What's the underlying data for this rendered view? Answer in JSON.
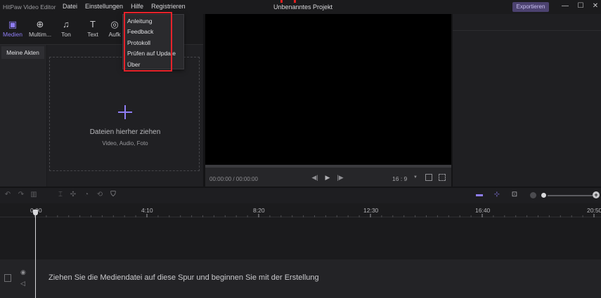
{
  "titlebar": {
    "app_title": "HitPaw Video Editor",
    "menu": [
      "Datei",
      "Einstellungen",
      "Hilfe",
      "Registrieren"
    ],
    "project_title": "Unbenanntes Projekt",
    "export_label": "Exportieren",
    "window_controls": {
      "minimize": "—",
      "maximize": "☐",
      "close": "✕"
    }
  },
  "tabs": [
    {
      "label": "Medien",
      "icon": "media-icon",
      "glyph": "▣",
      "active": true
    },
    {
      "label": "Multim...",
      "icon": "globe-icon",
      "glyph": "⊕",
      "active": false
    },
    {
      "label": "Ton",
      "icon": "music-note-icon",
      "glyph": "♫",
      "active": false
    },
    {
      "label": "Text",
      "icon": "text-icon",
      "glyph": "T",
      "active": false
    },
    {
      "label": "Aufk",
      "icon": "sticker-icon",
      "glyph": "◎",
      "active": false
    }
  ],
  "leftnav": {
    "items": [
      "Meine Akten"
    ]
  },
  "media": {
    "drop_title": "Dateien hierher ziehen",
    "drop_subtitle": "Video, Audio, Foto"
  },
  "help_menu": {
    "items": [
      "Anleitung",
      "Feedback",
      "Protokoll",
      "Prüfen auf Update",
      "Über"
    ]
  },
  "preview": {
    "timecode": "00:00:00 / 00:00:00",
    "aspect_ratio": "16 : 9",
    "controls": {
      "prev": "◀|",
      "play": "▶",
      "next": "|▶"
    }
  },
  "timeline": {
    "ruler_labels": [
      "0:00",
      "4:10",
      "8:20",
      "12:30",
      "16:40",
      "20:50"
    ],
    "track_hint": "Ziehen Sie die Mediendatei auf diese Spur und beginnen Sie mit der Erstellung",
    "zoom_plus": "+"
  },
  "colors": {
    "accent": "#8f7df5",
    "highlight": "#e8232b",
    "export_bg": "#4c4270"
  }
}
